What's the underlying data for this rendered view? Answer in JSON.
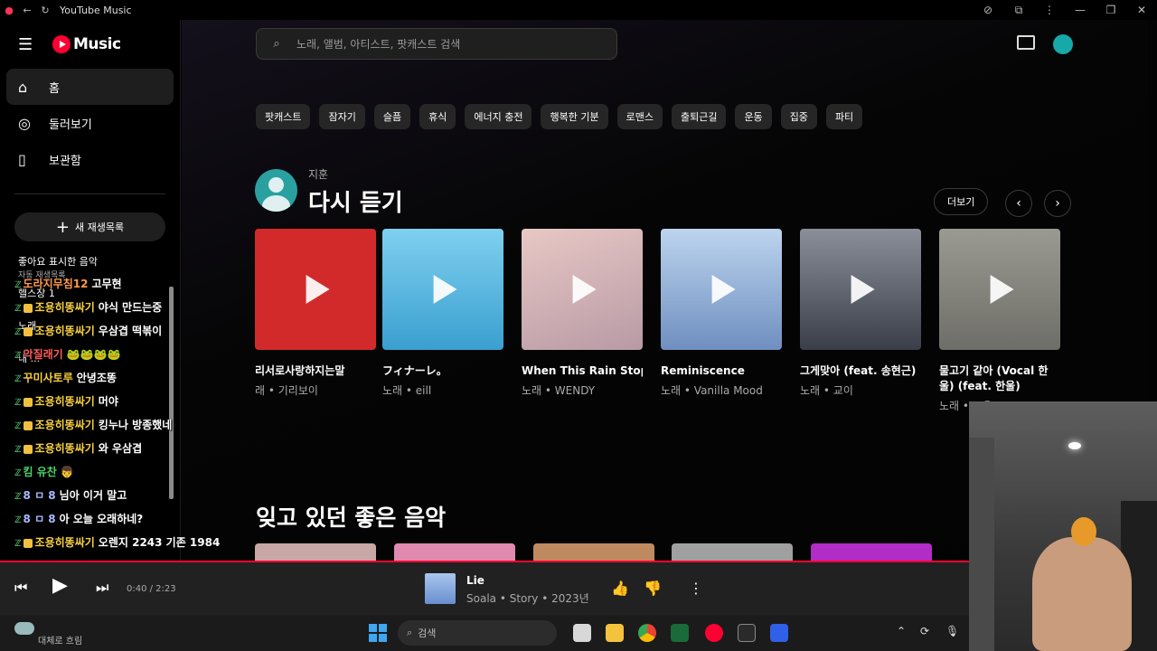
{
  "window": {
    "title": "YouTube Music",
    "nav_icons": [
      "back-arrow-icon",
      "reload-icon"
    ],
    "right_icons": [
      "eye-slash-icon",
      "extension-icon",
      "kebab-menu-icon",
      "minimize-icon",
      "maximize-icon",
      "close-icon"
    ]
  },
  "sidebar": {
    "logo_text": "Music",
    "items": [
      {
        "label": "홈",
        "icon": "home-icon",
        "active": true
      },
      {
        "label": "둘러보기",
        "icon": "compass-icon",
        "active": false
      },
      {
        "label": "보관함",
        "icon": "bookmark-icon",
        "active": false
      }
    ],
    "new_playlist_label": "새 재생목록",
    "playlists": [
      {
        "title": "좋아요 표시한 음악",
        "sub": "자동 재생목록"
      },
      {
        "title": "헬스장 1",
        "sub": ""
      },
      {
        "title": "노래",
        "sub": ""
      },
      {
        "title": "내 ...",
        "sub": ""
      }
    ]
  },
  "chat": [
    {
      "num": "",
      "nick": "도라지무침12",
      "text": "고무현",
      "nick_class": "nick-o",
      "badge": false
    },
    {
      "num": "",
      "nick": "조용히똥싸기",
      "text": "야식 만드는중",
      "nick_class": "nick-y",
      "badge": true
    },
    {
      "num": "",
      "nick": "조용히똥싸기",
      "text": "우삼겹 떡볶이",
      "nick_class": "nick-y",
      "badge": true
    },
    {
      "num": "",
      "nick": "악질래기",
      "text": "🐸🐸🐸🐸",
      "nick_class": "nick-r",
      "badge": false
    },
    {
      "num": "",
      "nick": "꾸미사토루",
      "text": "안녕조똥",
      "nick_class": "nick-y",
      "badge": false
    },
    {
      "num": "",
      "nick": "조용히똥싸기",
      "text": "머야",
      "nick_class": "nick-y",
      "badge": true
    },
    {
      "num": "",
      "nick": "조용히똥싸기",
      "text": "킹누나 방종했네",
      "nick_class": "nick-y",
      "badge": true
    },
    {
      "num": "",
      "nick": "조용히똥싸기",
      "text": "와 우삼겹",
      "nick_class": "nick-y",
      "badge": true
    },
    {
      "num": "",
      "nick": "킴 유찬",
      "text": "👦",
      "nick_class": "nick-g",
      "badge": false
    },
    {
      "num": "8 ㅁ 8",
      "nick": "",
      "text": "님아 이거 말고",
      "nick_class": "nick-w",
      "badge": false
    },
    {
      "num": "8 ㅁ 8",
      "nick": "",
      "text": "아 오늘 오래하네?",
      "nick_class": "nick-w",
      "badge": false
    },
    {
      "num": "",
      "nick": "조용히똥싸기",
      "text": "오렌지 2243 기존 1984",
      "nick_class": "nick-y",
      "badge": true
    },
    {
      "num": "8 ㅁ 8",
      "nick": "",
      "text": "이건",
      "nick_class": "nick-w",
      "badge": false
    },
    {
      "num": "8 ㅁ 8",
      "nick": "",
      "text": "번겜임",
      "nick_class": "nick-w",
      "badge": false
    }
  ],
  "main": {
    "search_placeholder": "노래, 앨범, 아티스트, 팟캐스트 검색",
    "top_icons": [
      "cast-icon",
      "account-avatar"
    ],
    "chips": [
      "팟캐스트",
      "잠자기",
      "슬픔",
      "휴식",
      "에너지 충전",
      "행복한 기분",
      "로맨스",
      "출퇴근길",
      "운동",
      "집중",
      "파티"
    ],
    "section1": {
      "subtitle": "지훈",
      "title": "다시 듣기",
      "more_label": "더보기",
      "cards": [
        {
          "title": "리서로사랑하지는말",
          "sub": "래 • 기리보이",
          "color": "#d22a2a"
        },
        {
          "title": "フィナーレ。",
          "sub": "노래 • eill",
          "color": "#5fb8e0"
        },
        {
          "title": "When This Rain Stops",
          "sub": "노래 • WENDY",
          "color": "#d9b3b8"
        },
        {
          "title": "Reminiscence",
          "sub": "노래 • Vanilla Mood",
          "color": "#8fb0d6"
        },
        {
          "title": "그게맞아 (feat. 송현근)",
          "sub": "노래 • 교이",
          "color": "#7a7f8a"
        },
        {
          "title": "물고기 같아 (Vocal 한울) (feat. 한울)",
          "sub": "노래 • 노을",
          "color": "#8a8a82"
        }
      ]
    },
    "section2": {
      "title": "잊고 있던 좋은 음악",
      "thumb_colors": [
        "#c9a7a7",
        "#e08ab0",
        "#c08a60",
        "#a0a0a0",
        "#b22cc8"
      ]
    }
  },
  "player": {
    "time": "0:40 / 2:23",
    "song": "Lie",
    "meta": "Soala • Story • 2023년"
  },
  "taskbar": {
    "weather_title": "대체로 흐림",
    "search_label": "검색",
    "apps": [
      "task-view-icon",
      "file-explorer-icon",
      "chrome-icon",
      "media-app-icon",
      "youtube-music-icon",
      "obs-icon",
      "roblox-icon"
    ]
  }
}
